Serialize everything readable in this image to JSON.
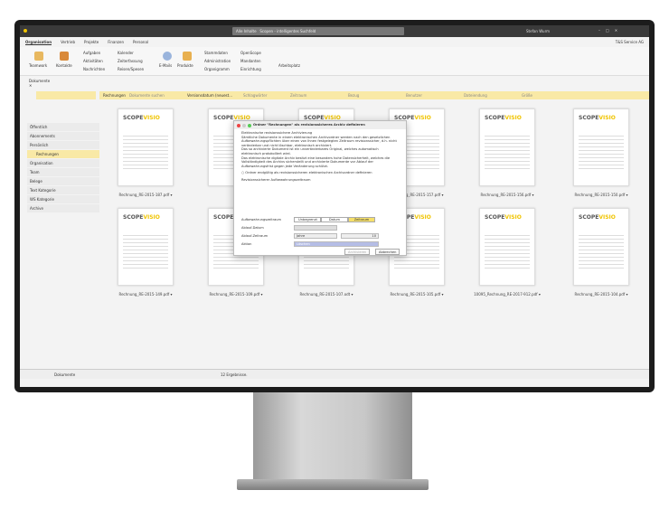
{
  "titlebar": {
    "search_scope": "Alle Inhalte",
    "search_placeholder": "Scopen - intelligentes Suchfeld",
    "user": "Stefan Wurm",
    "company": "T&S Service AG"
  },
  "menu_tabs": [
    "Organisation",
    "Vertrieb",
    "Projekte",
    "Finanzen",
    "Personal"
  ],
  "ribbon": {
    "teamwork": "Teamwork",
    "kontakte": "Kontakte",
    "aufgaben": "Aufgaben",
    "aktivitaeten": "Aktivitäten",
    "nachrichten": "Nachrichten",
    "kalender": "Kalender",
    "zeiterfassung": "Zeiterfassung",
    "reisen": "Reisen/Spesen",
    "emails": "E-Mails",
    "produkte": "Produkte",
    "stammdaten": "Stammdaten",
    "administration": "Administration",
    "organigramm": "Organigramm",
    "openscope": "OpenScope",
    "mandanten": "Mandanten",
    "einrichtung": "Einrichtung",
    "arbeitsplatz": "Arbeitsplatz"
  },
  "doc_tab": "Dokumente",
  "filters": {
    "folder": "Rechnungen",
    "search_placeholder": "Dokumente suchen",
    "sort": "Versionsdatum (neuest...",
    "schlagwoerter": "Schlagwörter",
    "zeitraum": "Zeitraum",
    "bezug": "Bezug",
    "benutzer": "Benutzer",
    "dateiendung": "Dateiendung",
    "groesse": "Größe"
  },
  "sidebar": [
    {
      "label": "Öffentlich"
    },
    {
      "label": "Abonnements"
    },
    {
      "label": "Persönlich"
    },
    {
      "label": "Rechnungen",
      "selected": true
    },
    {
      "label": "Organisation"
    },
    {
      "label": "Team"
    },
    {
      "label": "Belege"
    },
    {
      "label": "Text Kategorie"
    },
    {
      "label": "WS Kategorie"
    },
    {
      "label": "Archive"
    }
  ],
  "files": [
    "Rechnung_RE-2015-187.pdf",
    "",
    "",
    "Rechnung_RE-2015-157.pdf",
    "Rechnung_RE-2015-156.pdf",
    "Rechnung_RE-2015-150.pdf",
    "Rechnung_RE-2015-149.pdf",
    "Rechnung_RE-2015-109.pdf",
    "Rechnung_RE-2015-107.odt",
    "Rechnung_RE-2015-105.pdf",
    "10095_Rechnung_RE-2017-912.pdf",
    "Rechnung_RE-2015-104.pdf"
  ],
  "logo": {
    "a": "SCOPE",
    "b": "VISIO"
  },
  "dialog": {
    "title": "Ordner \"Rechnungen\" als revisionssicheres Archiv definieren",
    "section1": "Elektronische revisionssichere Archivierung",
    "p1": "Sämtliche Dokumente in einem elektronischen Archivordner werden nach den gesetzlichen Aufbewahrungspflichten über einen von Ihnen festgelegten Zeitraum revisionssicher, d.h. nicht veränderbar und nicht löschbar, elektronisch archiviert.",
    "p2": "Das so archivierte Dokument ist ein unveränderbares Original, welches automatisch elektronisch protokolliert wird.",
    "p3": "Das elektronische digitale Archiv besitzt eine besonders hohe Datensicherheit, welches die Vollständigkeit des Archivs sicherstellt und archivierte Dokumente vor Ablauf der Aufbewahrungsfrist gegen jede Veränderung schützt.",
    "checkbox": "Ordner endgültig als revisionssicheren elektronischen Archivordner definieren",
    "section2": "Revisionssicherer Aufbewahrungszeitraum",
    "lbl_zeitraum": "Aufbewahrungszeitraum",
    "seg": [
      "Unbegrenzt",
      "Datum",
      "Zeitraum"
    ],
    "seg_active": 2,
    "lbl_ablaufdatum": "Ablauf-Datum",
    "lbl_ablaufzeitraum": "Ablauf-Zeitraum",
    "unit": "Jahre",
    "years": "10",
    "lbl_aktion": "Aktion",
    "aktion": "Löschen",
    "archive_btn": "Archivieren",
    "cancel_btn": "Abbrechen"
  },
  "status": {
    "section": "Dokumente",
    "results": "12 Ergebnisse."
  },
  "colors": {
    "accent": "#f0c400",
    "filter_bg": "#f9e9a6"
  }
}
